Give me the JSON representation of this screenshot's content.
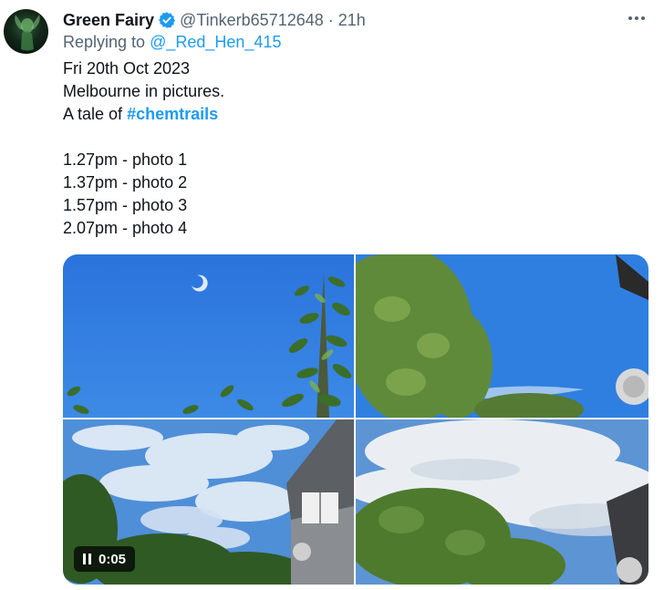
{
  "tweet": {
    "author_name": "Green Fairy",
    "handle": "@Tinkerb65712648",
    "separator": "·",
    "time": "21h",
    "replying_prefix": "Replying to",
    "replying_to": "@_Red_Hen_415",
    "lines": {
      "line1": "Fri 20th Oct 2023",
      "line2": "Melbourne in pictures.",
      "line3_prefix": "A tale of",
      "hashtag": "#chemtrails",
      "line4": "1.27pm - photo 1",
      "line5": "1.37pm - photo 2",
      "line6": "1.57pm - photo 3",
      "line7": "2.07pm - photo 4"
    },
    "video_time": "0:05"
  },
  "colors": {
    "accent": "#1d9bf0",
    "text": "#0f1419",
    "muted": "#536471",
    "sky": "#2f7fe0"
  },
  "icons": [
    "avatar",
    "verified-icon",
    "more-icon",
    "pause-icon"
  ]
}
